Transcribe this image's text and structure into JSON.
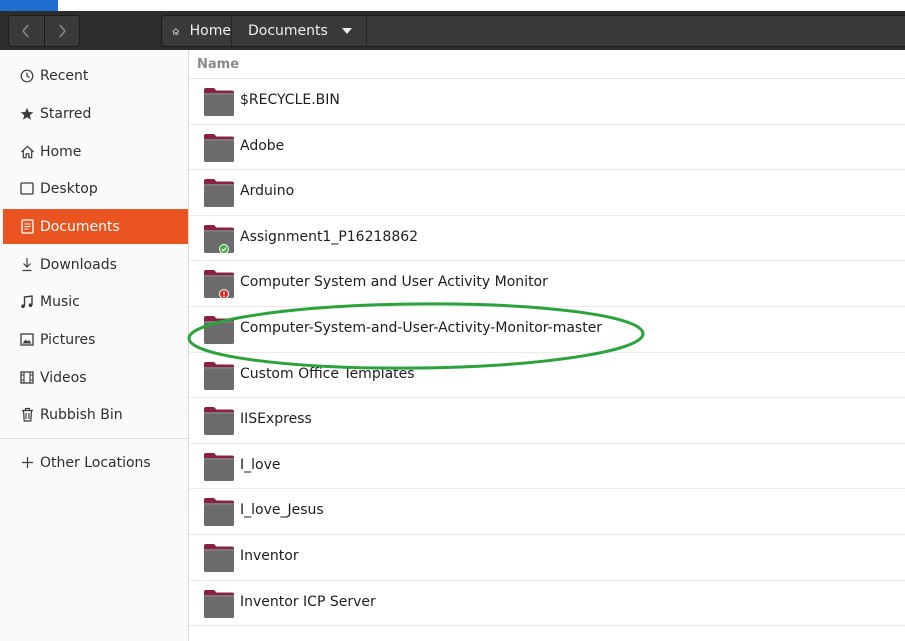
{
  "toolbar": {
    "back_icon": "chevron-left-icon",
    "forward_icon": "chevron-right-icon",
    "breadcrumbs": [
      {
        "label": "Home",
        "icon": "home-icon"
      },
      {
        "label": "Documents",
        "icon": "caret-down-icon"
      }
    ]
  },
  "sidebar": {
    "items": [
      {
        "label": "Recent",
        "icon": "clock-icon"
      },
      {
        "label": "Starred",
        "icon": "star-icon"
      },
      {
        "label": "Home",
        "icon": "home-icon"
      },
      {
        "label": "Desktop",
        "icon": "desktop-icon"
      },
      {
        "label": "Documents",
        "icon": "document-icon",
        "active": true
      },
      {
        "label": "Downloads",
        "icon": "download-icon"
      },
      {
        "label": "Music",
        "icon": "music-icon"
      },
      {
        "label": "Pictures",
        "icon": "picture-icon"
      },
      {
        "label": "Videos",
        "icon": "video-icon"
      },
      {
        "label": "Rubbish Bin",
        "icon": "trash-icon"
      }
    ],
    "other": {
      "label": "Other Locations",
      "icon": "plus-icon"
    }
  },
  "file_list": {
    "column_header": "Name",
    "rows": [
      {
        "name": "$RECYCLE.BIN",
        "icon": "folder-icon"
      },
      {
        "name": "Adobe",
        "icon": "folder-icon"
      },
      {
        "name": "Arduino",
        "icon": "folder-icon"
      },
      {
        "name": "Assignment1_P16218862",
        "icon": "folder-icon",
        "emblem": "check-emblem"
      },
      {
        "name": "Computer System and User Activity Monitor",
        "icon": "folder-icon",
        "emblem": "error-emblem"
      },
      {
        "name": "Computer-System-and-User-Activity-Monitor-master",
        "icon": "folder-icon",
        "highlighted": true
      },
      {
        "name": "Custom Office Templates",
        "icon": "folder-icon"
      },
      {
        "name": "IISExpress",
        "icon": "folder-icon"
      },
      {
        "name": "I_love",
        "icon": "folder-icon"
      },
      {
        "name": "I_love_Jesus",
        "icon": "folder-icon"
      },
      {
        "name": "Inventor",
        "icon": "folder-icon"
      },
      {
        "name": "Inventor ICP Server",
        "icon": "folder-icon"
      }
    ]
  },
  "colors": {
    "accent": "#e95420",
    "headerbar": "#2d2d2d",
    "folder_body": "#6b6b6b",
    "folder_tab": "#8b2040",
    "annotation_ellipse": "#2aa33a"
  }
}
